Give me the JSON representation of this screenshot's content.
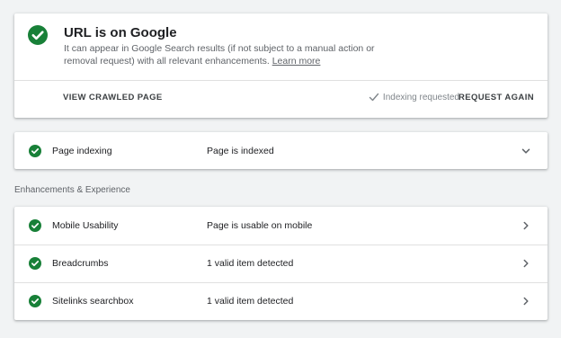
{
  "status": {
    "title": "URL is on Google",
    "description": "It can appear in Google Search results (if not subject to a manual action or removal request) with all relevant enhancements.",
    "learn_more": "Learn more",
    "view_crawled": "VIEW CRAWLED PAGE",
    "indexing_requested": "Indexing requested",
    "request_again": "REQUEST AGAIN",
    "icon": "check-circle-icon",
    "color": "#188038"
  },
  "page_indexing": {
    "label": "Page indexing",
    "value": "Page is indexed",
    "icon": "chevron-down-icon"
  },
  "enhancements": {
    "heading": "Enhancements & Experience",
    "items": [
      {
        "label": "Mobile Usability",
        "value": "Page is usable on mobile"
      },
      {
        "label": "Breadcrumbs",
        "value": "1 valid item detected"
      },
      {
        "label": "Sitelinks searchbox",
        "value": "1 valid item detected"
      }
    ]
  }
}
